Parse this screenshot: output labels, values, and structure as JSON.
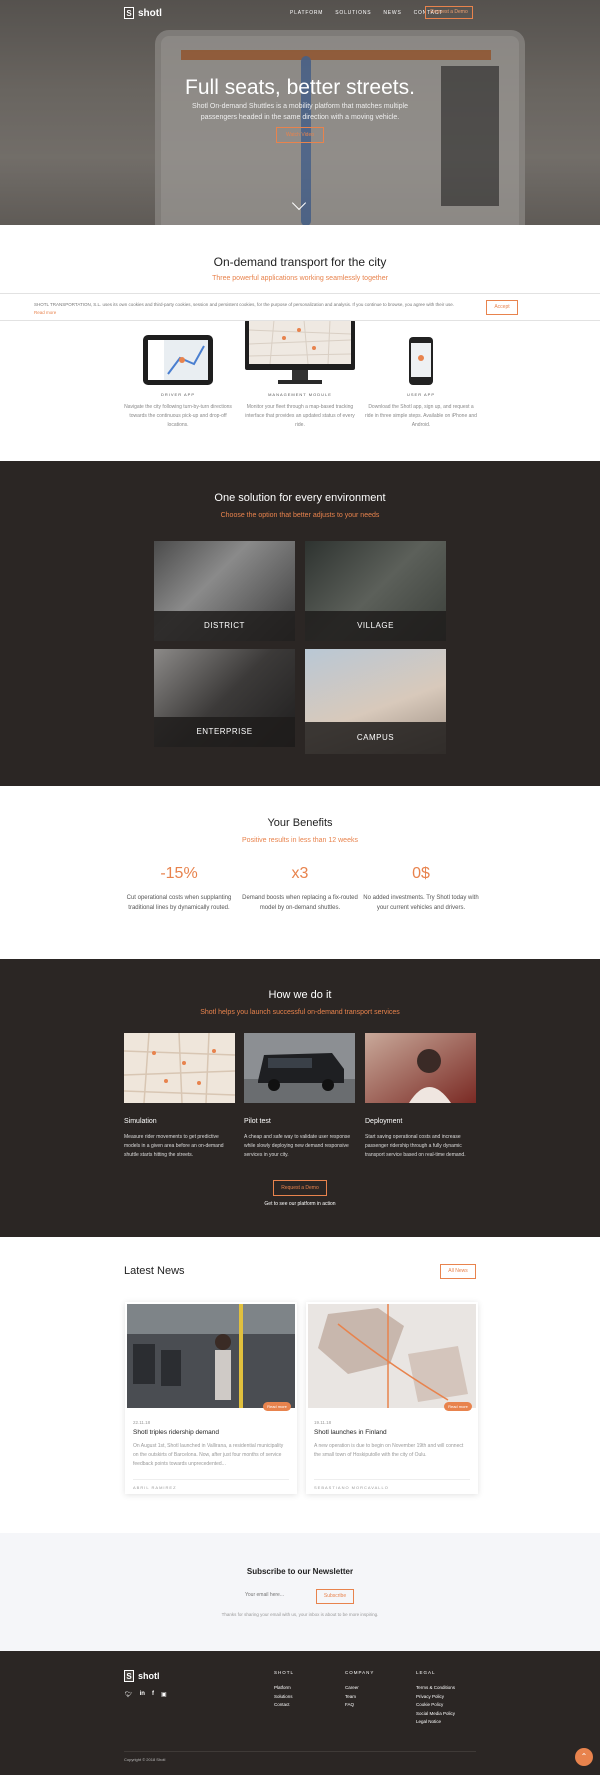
{
  "nav": {
    "logo": "shotl",
    "logo_mark": "S",
    "links": [
      "PLATFORM",
      "SOLUTIONS",
      "NEWS",
      "CONTACT"
    ],
    "cta": "Request a Demo"
  },
  "hero": {
    "title": "Full seats, better streets.",
    "text": "Shotl On-demand Shuttles is a mobility platform that matches multiple passengers headed in the same direction with a moving vehicle.",
    "cta": "Watch Video"
  },
  "ondemand": {
    "title": "On-demand transport for the city",
    "subtitle": "Three powerful applications working seamlessly together",
    "apps": [
      {
        "label": "DRIVER APP",
        "desc": "Navigate the city following turn-by-turn directions towards the continuous pick-up and drop-off locations."
      },
      {
        "label": "MANAGEMENT MODULE",
        "desc": "Monitor your fleet through a map-based tracking interface that provides an updated status of every ride."
      },
      {
        "label": "USER APP",
        "desc": "Download the Shotl app, sign up, and request a ride in three simple steps. Available on iPhone and Android."
      }
    ]
  },
  "cookie": {
    "text": "SHOTL TRANSPORTATION, S.L. uses its own cookies and third-party cookies, session and persistent cookies, for the purpose of personalization and analysis. If you continue to browse, you agree with their use.",
    "link": "Read more",
    "accept": "Accept"
  },
  "environments": {
    "title": "One solution for every environment",
    "subtitle": "Choose the option that better adjusts to your needs",
    "tiles": [
      "DISTRICT",
      "VILLAGE",
      "ENTERPRISE",
      "CAMPUS"
    ]
  },
  "benefits": {
    "title": "Your Benefits",
    "subtitle": "Positive results in less than 12 weeks",
    "stats": [
      {
        "num": "-15%",
        "text": "Cut operational costs when supplanting traditional lines by dynamically routed."
      },
      {
        "num": "x3",
        "text": "Demand boosts when replacing a fix-routed model by on-demand shuttles."
      },
      {
        "num": "0$",
        "text": "No added investments. Try Shotl today with your current vehicles and drivers."
      }
    ]
  },
  "how": {
    "title": "How we do it",
    "subtitle": "Shotl helps you launch successful on-demand transport services",
    "cards": [
      {
        "title": "Simulation",
        "text": "Measure rider movements to get predictive models in a given area before an on-demand shuttle starts hitting the streets."
      },
      {
        "title": "Pilot test",
        "text": "A cheap and safe way to validate user response while slowly deploying new demand responsive services in your city."
      },
      {
        "title": "Deployment",
        "text": "Start saving operational costs and increase passenger ridership through a fully dynamic transport service based on real-time demand."
      }
    ],
    "cta": "Request a Demo",
    "note": "Get to see our platform in action"
  },
  "news": {
    "title": "Latest News",
    "all": "All News",
    "read_label": "Read more",
    "cards": [
      {
        "date": "22.11.18",
        "title": "Shotl triples ridership demand",
        "excerpt": "On August 1st, Shotl launched in Vallirana, a residential municipality on the outskirts of Barcelona. Now, after just four months of service feedback points towards unprecedented...",
        "author": "ABRIL RAMIREZ"
      },
      {
        "date": "19.11.18",
        "title": "Shotl launches in Finland",
        "excerpt": "A new operation is due to begin on November 19th and will connect the small town of Hoskiputolle with the city of Oulu.",
        "author": "SEBASTIANO MORCAVALLO"
      }
    ]
  },
  "newsletter": {
    "title": "Subscribe to our Newsletter",
    "placeholder": "Your email here...",
    "button": "Subscribe",
    "thanks": "Thanks for sharing your email with us, your inbox is about to be more inspiring."
  },
  "footer": {
    "logo": "shotl",
    "logo_mark": "S",
    "socials": [
      "twitter-icon",
      "linkedin-icon",
      "facebook-icon",
      "instagram-icon"
    ],
    "cols": [
      {
        "title": "SHOTL",
        "links": [
          "Platform",
          "Solutions",
          "Contact"
        ]
      },
      {
        "title": "COMPANY",
        "links": [
          "Career",
          "Team",
          "FAQ"
        ]
      },
      {
        "title": "LEGAL",
        "links": [
          "Terms & Conditions",
          "Privacy Policy",
          "Cookie Policy",
          "Social Media Policy",
          "Legal Notice"
        ]
      }
    ],
    "copyright": "Copyright © 2018 Shotl"
  },
  "colors": {
    "accent": "#e8834d",
    "dark": "#2b2624"
  }
}
